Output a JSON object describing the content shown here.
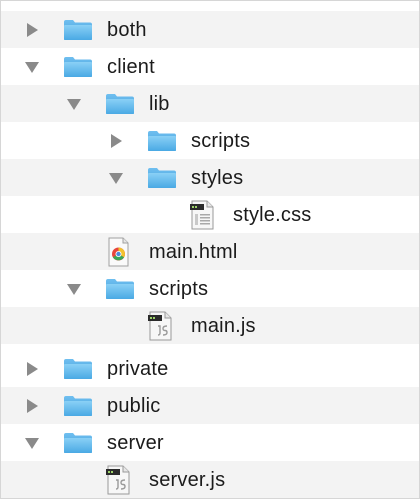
{
  "file_tree": {
    "items": [
      {
        "label": "both",
        "type": "folder",
        "state": "collapsed",
        "icon": "folder-icon"
      },
      {
        "label": "client",
        "type": "folder",
        "state": "expanded",
        "icon": "folder-icon"
      },
      {
        "label": "lib",
        "type": "folder",
        "state": "expanded",
        "icon": "folder-icon"
      },
      {
        "label": "scripts",
        "type": "folder",
        "state": "collapsed",
        "icon": "folder-icon"
      },
      {
        "label": "styles",
        "type": "folder",
        "state": "expanded",
        "icon": "folder-icon"
      },
      {
        "label": "style.css",
        "type": "file",
        "icon": "css-file-icon"
      },
      {
        "label": "main.html",
        "type": "file",
        "icon": "html-file-icon"
      },
      {
        "label": "scripts",
        "type": "folder",
        "state": "expanded",
        "icon": "folder-icon"
      },
      {
        "label": "main.js",
        "type": "file",
        "icon": "js-file-icon"
      },
      {
        "label": "private",
        "type": "folder",
        "state": "collapsed",
        "icon": "folder-icon"
      },
      {
        "label": "public",
        "type": "folder",
        "state": "collapsed",
        "icon": "folder-icon"
      },
      {
        "label": "server",
        "type": "folder",
        "state": "expanded",
        "icon": "folder-icon"
      },
      {
        "label": "server.js",
        "type": "file",
        "icon": "js-file-icon"
      }
    ]
  },
  "colors": {
    "folder_blue": "#5eb6ec",
    "disclosure_gray": "#8a8a8a",
    "row_alt": "#f3f3f3",
    "text": "#1b1b1b"
  }
}
